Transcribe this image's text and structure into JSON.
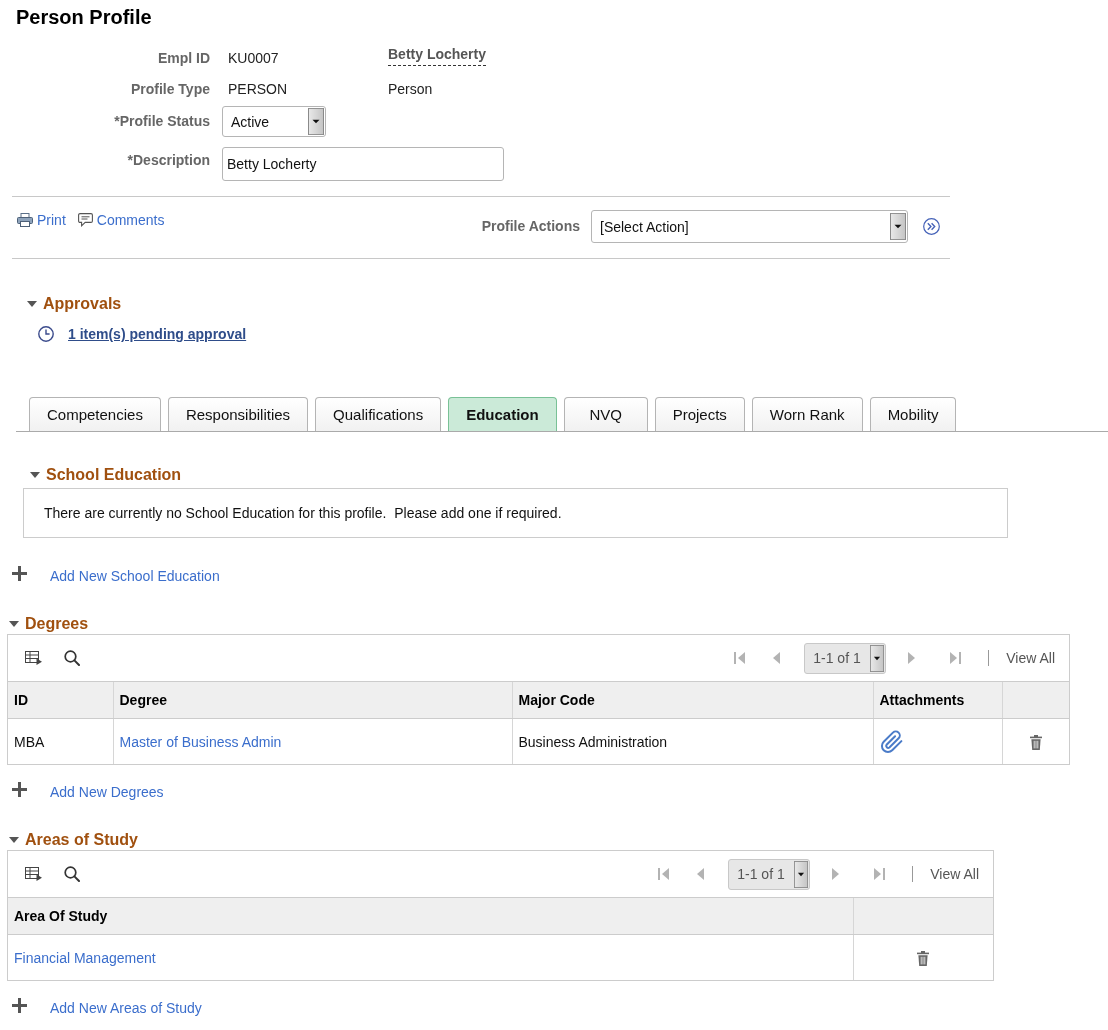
{
  "page": {
    "title": "Person Profile"
  },
  "profile": {
    "empl_id": {
      "label": "Empl ID",
      "value": "KU0007",
      "name": "Betty Locherty"
    },
    "profile_type": {
      "label": "Profile Type",
      "value": "PERSON",
      "description": "Person"
    },
    "profile_status": {
      "label": "*Profile Status",
      "value": "Active"
    },
    "description": {
      "label": "*Description",
      "value": "Betty Locherty"
    }
  },
  "action_bar": {
    "links": [
      {
        "kind": "print",
        "label": "Print"
      },
      {
        "kind": "comments",
        "label": "Comments"
      }
    ],
    "profile_actions": {
      "label": "Profile Actions",
      "value": "[Select Action]"
    }
  },
  "approvals": {
    "title": "Approvals",
    "expanded": true,
    "items": [
      {
        "label": "1 item(s) pending approval"
      }
    ]
  },
  "tabs": [
    {
      "label": "Competencies",
      "selected": false
    },
    {
      "label": "Responsibilities",
      "selected": false
    },
    {
      "label": "Qualifications",
      "selected": false
    },
    {
      "label": "Education",
      "selected": true
    },
    {
      "label": "NVQ",
      "selected": false
    },
    {
      "label": "Projects",
      "selected": false
    },
    {
      "label": "Worn Rank",
      "selected": false
    },
    {
      "label": "Mobility",
      "selected": false
    }
  ],
  "sections": [
    {
      "kind": "message",
      "title": "School Education",
      "expanded": true,
      "message": "There are currently no School Education for this profile.  Please add one if required.",
      "add_link": "Add New School Education"
    },
    {
      "kind": "grid",
      "title": "Degrees",
      "expanded": true,
      "grid": {
        "pager": {
          "range": "1-1 of 1",
          "nav_disabled": true,
          "view_all": "View All"
        },
        "columns": [
          {
            "label": "ID",
            "kind": "text"
          },
          {
            "label": "Degree",
            "kind": "link"
          },
          {
            "label": "Major Code",
            "kind": "text"
          },
          {
            "label": "Attachments",
            "kind": "attachment"
          }
        ],
        "rows": [
          {
            "cells": [
              "MBA",
              "Master of Business Admin",
              "Business Administration"
            ],
            "attachment": true
          }
        ]
      },
      "add_link": "Add New Degrees"
    },
    {
      "kind": "grid",
      "title": "Areas of Study",
      "expanded": true,
      "grid": {
        "pager": {
          "range": "1-1 of 1",
          "nav_disabled": true,
          "view_all": "View All"
        },
        "columns": [
          {
            "label": "Area Of Study",
            "kind": "link"
          }
        ],
        "rows": [
          {
            "cells": [
              "Financial Management"
            ]
          }
        ]
      },
      "add_link": "Add New Areas of Study"
    }
  ]
}
